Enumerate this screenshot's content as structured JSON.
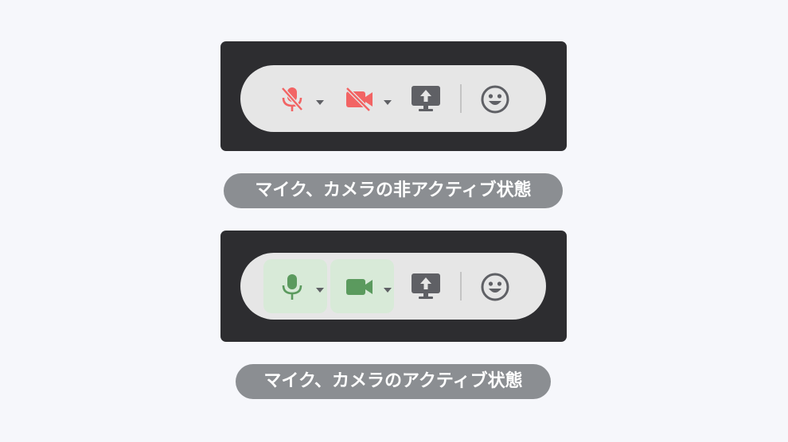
{
  "colors": {
    "background": "#f6f7fb",
    "panel": "#2d2d30",
    "pill": "#e6e6e6",
    "muted_red": "#f26464",
    "active_green": "#5b9a5e",
    "active_bg": "#d8ead8",
    "icon_gray": "#5f6065",
    "label_bg": "#8b8e92"
  },
  "inactive_state": {
    "caption": "マイク、カメラの非アクティブ状態",
    "mic": {
      "icon": "mic-off-icon",
      "state": "muted"
    },
    "camera": {
      "icon": "videocam-off-icon",
      "state": "off"
    },
    "share": {
      "icon": "screen-share-icon"
    },
    "reaction": {
      "icon": "smiley-icon"
    }
  },
  "active_state": {
    "caption": "マイク、カメラのアクティブ状態",
    "mic": {
      "icon": "mic-icon",
      "state": "on"
    },
    "camera": {
      "icon": "videocam-icon",
      "state": "on"
    },
    "share": {
      "icon": "screen-share-icon"
    },
    "reaction": {
      "icon": "smiley-icon"
    }
  }
}
